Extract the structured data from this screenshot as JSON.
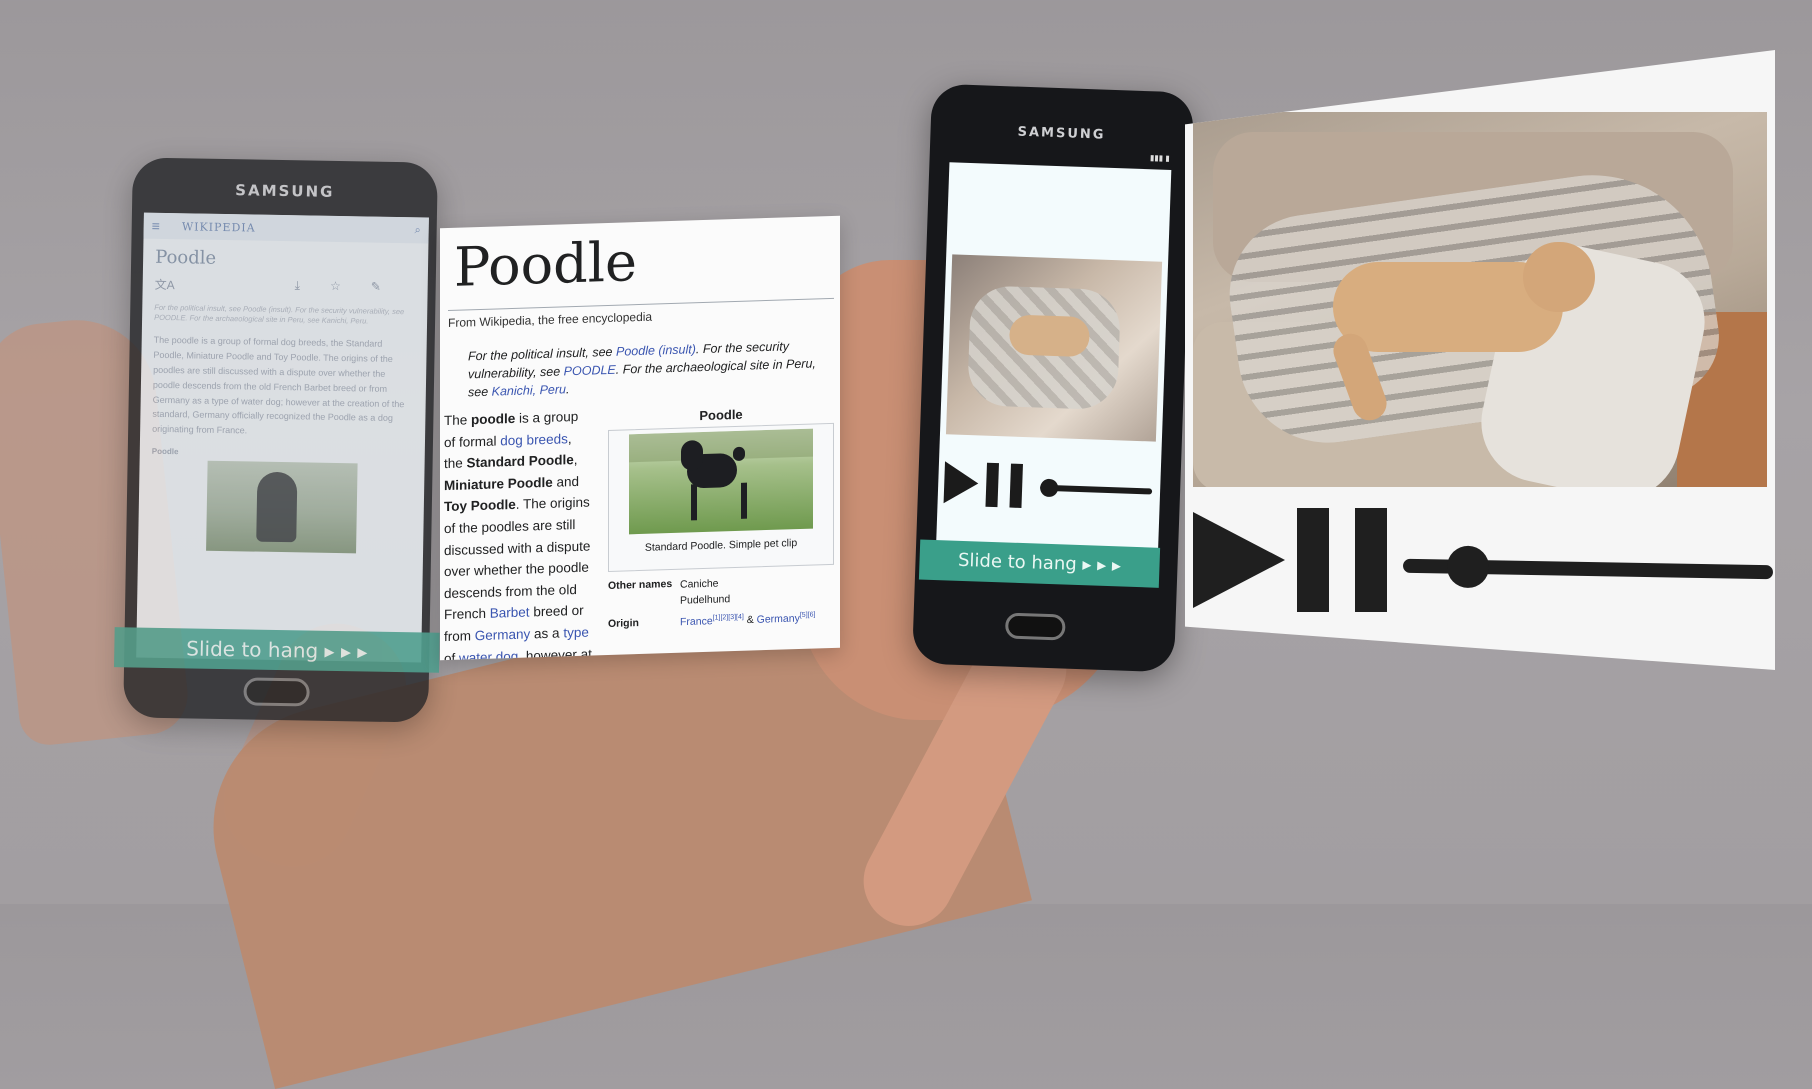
{
  "left_phone": {
    "brand": "SAMSUNG",
    "app_name": "WIKIPEDIA",
    "page_title": "Poodle",
    "hatnote": "For the political insult, see Poodle (insult). For the security vulnerability, see POODLE. For the archaeological site in Peru, see Kanichi, Peru.",
    "body": "The poodle is a group of formal dog breeds, the Standard Poodle, Miniature Poodle and Toy Poodle. The origins of the poodles are still discussed with a dispute over whether the poodle descends from the old French Barbet breed or from Germany as a type of water dog; however at the creation of the standard, Germany officially recognized the Poodle as a dog originating from France.",
    "infobox_label": "Poodle",
    "slide_label": "Slide to hang ▸ ▸ ▸",
    "icons": [
      "menu-icon",
      "search-icon",
      "translate-icon",
      "download-icon",
      "star-icon",
      "edit-icon"
    ]
  },
  "wiki_card": {
    "title": "Poodle",
    "tagline": "From Wikipedia, the free encyclopedia",
    "hatnote": {
      "p1": "For the political insult, see ",
      "link1": "Poodle (insult)",
      "p2": ". For the security vulnerability, see ",
      "link2": "POODLE",
      "p3": ". For the archaeological site in Peru, see ",
      "link3": "Kanichi, Peru",
      "p4": "."
    },
    "body": {
      "t1": "The ",
      "b1": "poodle",
      "t2": " is a group of formal ",
      "l1": "dog breeds",
      "t3": ", the ",
      "b2": "Standard Poodle",
      "t4": ", ",
      "b3": "Miniature Poodle",
      "t5": " and ",
      "b4": "Toy Poodle",
      "t6": ". The origins of the poodles are still discussed with a dispute over whether the poodle descends from the old French ",
      "l2": "Barbet",
      "t7": " breed or from ",
      "l3": "Germany",
      "t8": " as a ",
      "l4": "type",
      "t9": " of ",
      "l5": "water dog",
      "t10": ", however at"
    },
    "infobox": {
      "title": "Poodle",
      "caption": "Standard Poodle. Simple pet clip",
      "rows": [
        {
          "label": "Other names",
          "value": "Caniche\nPudelhund"
        },
        {
          "label": "Origin",
          "value_link1": "France",
          "refs1": "[1][2][3][4]",
          "and": " & ",
          "value_link2": "Germany",
          "refs2": "[5][6]"
        }
      ]
    }
  },
  "center_phone": {
    "brand": "SAMSUNG",
    "slide_label": "Slide to hang ▸ ▸ ▸",
    "controls": [
      "play-icon",
      "pause-icon",
      "seek-slider"
    ]
  },
  "video_card": {
    "controls": [
      "play-icon",
      "pause-icon",
      "seek-slider"
    ],
    "seek_progress": 0.12
  },
  "colors": {
    "teal": "#3a9f8a",
    "link": "#3a55b0",
    "background": "#a29ea1"
  }
}
